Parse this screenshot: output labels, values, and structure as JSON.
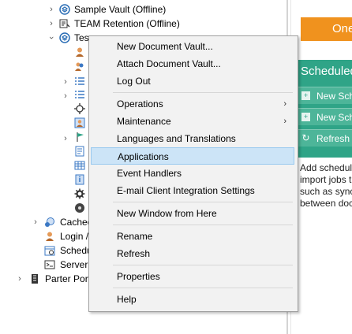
{
  "tree": {
    "vault1": "Sample Vault (Offline)",
    "vault2": "TEAM Retention (Offline)",
    "vault3_partial": "Tes",
    "cached": "Cached",
    "login": "Login /",
    "schedule": "Schedu",
    "server": "Server",
    "parter": "Parter Port"
  },
  "right_pane": {
    "orange_button": "One",
    "scheduled_title": "Scheduled",
    "new_schedule_1": "New Sch",
    "new_schedule_2": "New Sch",
    "refresh": "Refresh",
    "desc_lines": [
      "Add schedul",
      "import jobs t",
      "such as sync",
      "between doc"
    ]
  },
  "context_menu": {
    "items": [
      {
        "label": "New Document Vault...",
        "submenu": false,
        "highlighted": false
      },
      {
        "label": "Attach Document Vault...",
        "submenu": false,
        "highlighted": false
      },
      {
        "label": "Log Out",
        "submenu": false,
        "highlighted": false
      },
      {
        "label": "Operations",
        "submenu": true,
        "highlighted": false
      },
      {
        "label": "Maintenance",
        "submenu": true,
        "highlighted": false
      },
      {
        "label": "Languages and Translations",
        "submenu": false,
        "highlighted": false
      },
      {
        "label": "Applications",
        "submenu": false,
        "highlighted": true
      },
      {
        "label": "Event Handlers",
        "submenu": false,
        "highlighted": false
      },
      {
        "label": "E-mail Client Integration Settings",
        "submenu": false,
        "highlighted": false
      },
      {
        "label": "New Window from Here",
        "submenu": false,
        "highlighted": false
      },
      {
        "label": "Rename",
        "submenu": false,
        "highlighted": false
      },
      {
        "label": "Refresh",
        "submenu": false,
        "highlighted": false
      },
      {
        "label": "Properties",
        "submenu": false,
        "highlighted": false
      },
      {
        "label": "Help",
        "submenu": false,
        "highlighted": false
      }
    ],
    "submenu_arrow": "›"
  },
  "colors": {
    "accent_orange": "#f0921e",
    "panel_green": "#2fa487",
    "menu_highlight": "#cce4f7"
  }
}
